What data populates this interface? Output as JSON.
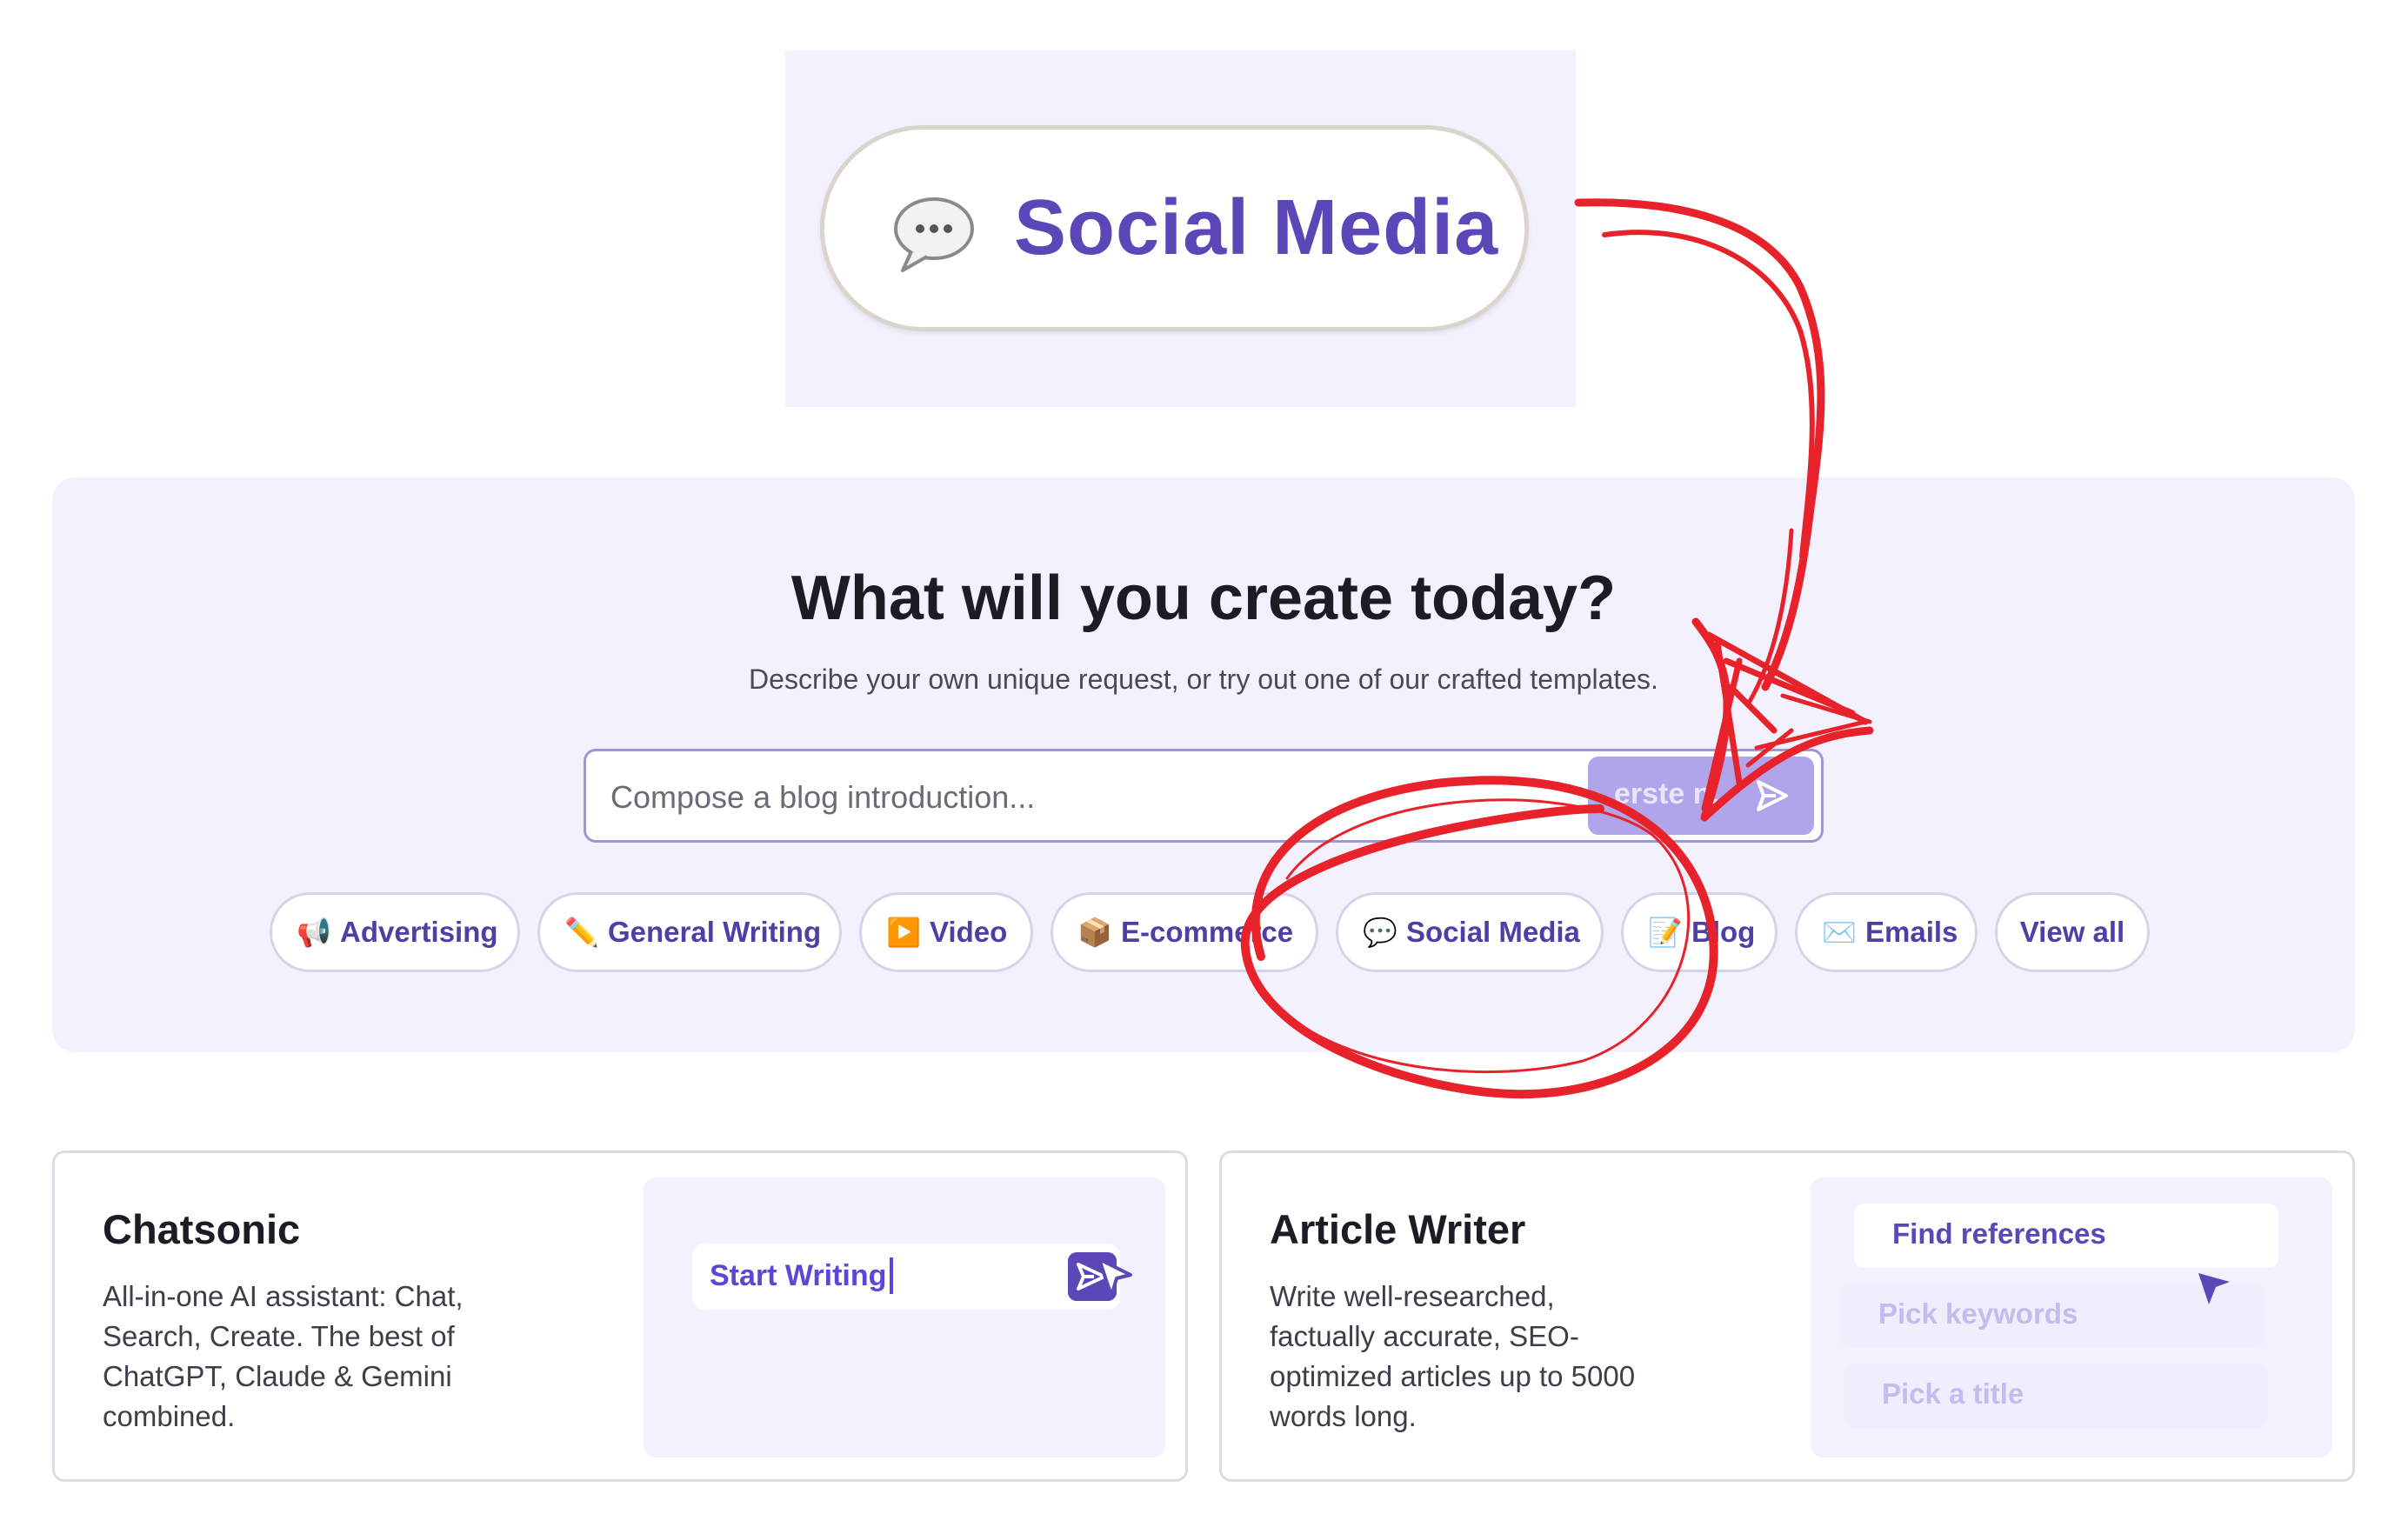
{
  "zoom_callout": {
    "label": "Social Media",
    "icon": "speech-bubble-icon"
  },
  "hero": {
    "title": "What will you create today?",
    "subtitle": "Describe your own unique request, or try out one of our crafted templates.",
    "prompt_placeholder": "Compose a blog introduction...",
    "send_button_text": "erste n."
  },
  "chips": [
    {
      "emoji": "📢",
      "label": "Advertising"
    },
    {
      "emoji": "✏️",
      "label": "General Writing"
    },
    {
      "emoji": "▶️",
      "label": "Video"
    },
    {
      "emoji": "📦",
      "label": "E-commerce"
    },
    {
      "emoji": "💬",
      "label": "Social Media"
    },
    {
      "emoji": "📝",
      "label": "Blog"
    },
    {
      "emoji": "✉️",
      "label": "Emails"
    },
    {
      "emoji": "",
      "label": "View all"
    }
  ],
  "cards": {
    "chatsonic": {
      "title": "Chatsonic",
      "description_lines": [
        "All-in-one AI assistant: Chat,",
        "Search, Create. The best of",
        "ChatGPT, Claude & Gemini",
        "combined."
      ],
      "preview_input": "Start Writing"
    },
    "article_writer": {
      "title": "Article Writer",
      "description_lines": [
        "Write well-researched,",
        "factually accurate, SEO-",
        "optimized articles up to 5000",
        "words long."
      ],
      "preview_items": [
        "Find references",
        "Pick keywords",
        "Pick a title"
      ]
    }
  },
  "colors": {
    "accent": "#5b47b8",
    "panel_bg": "#f4f1ff",
    "annotation_red": "#e8222a"
  }
}
